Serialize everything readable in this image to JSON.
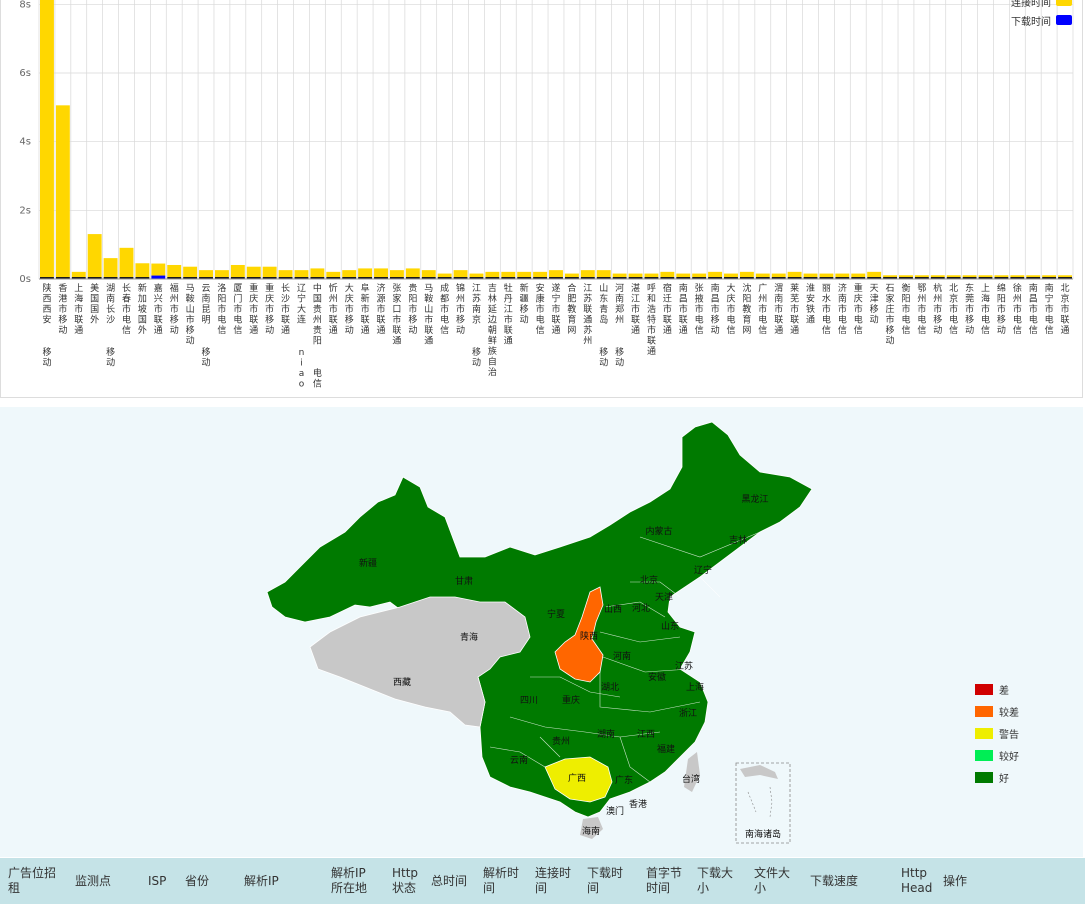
{
  "chart_data": {
    "type": "bar",
    "ylim": [
      0,
      9
    ],
    "yticks": [
      "0s",
      "2s",
      "4s",
      "6s",
      "8s"
    ],
    "ytick_values": [
      0,
      2,
      4,
      6,
      8
    ],
    "series": [
      {
        "name": "连接时间",
        "color": "#ffd700",
        "values": [
          10.5,
          5.0,
          0.15,
          1.25,
          0.55,
          0.85,
          0.4,
          0.35,
          0.35,
          0.3,
          0.2,
          0.2,
          0.35,
          0.3,
          0.3,
          0.2,
          0.2,
          0.25,
          0.15,
          0.2,
          0.25,
          0.25,
          0.2,
          0.25,
          0.2,
          0.1,
          0.2,
          0.1,
          0.15,
          0.15,
          0.15,
          0.15,
          0.2,
          0.1,
          0.2,
          0.2,
          0.1,
          0.1,
          0.1,
          0.15,
          0.1,
          0.1,
          0.15,
          0.1,
          0.15,
          0.1,
          0.1,
          0.15,
          0.1,
          0.1,
          0.1,
          0.1,
          0.15,
          0.05,
          0.05,
          0.05,
          0.05,
          0.05,
          0.05,
          0.05,
          0.05,
          0.05,
          0.05,
          0.05,
          0.05
        ]
      },
      {
        "name": "下载时间",
        "color": "#0000ff",
        "values": [
          0.02,
          0.01,
          0.01,
          0.01,
          0.01,
          0.01,
          0.01,
          0.1,
          0.01,
          0.01,
          0.01,
          0.01,
          0.01,
          0.01,
          0.01,
          0.01,
          0.01,
          0.01,
          0.01,
          0.01,
          0.01,
          0.01,
          0.01,
          0.01,
          0.01,
          0.01,
          0.01,
          0.01,
          0.01,
          0.01,
          0.01,
          0.01,
          0.01,
          0.01,
          0.01,
          0.01,
          0.01,
          0.01,
          0.01,
          0.01,
          0.01,
          0.01,
          0.01,
          0.01,
          0.01,
          0.01,
          0.01,
          0.01,
          0.01,
          0.01,
          0.01,
          0.01,
          0.01,
          0.01,
          0.01,
          0.01,
          0.01,
          0.01,
          0.01,
          0.01,
          0.01,
          0.01,
          0.01,
          0.01,
          0.01
        ]
      }
    ],
    "categories": [
      "陕西西安 移动",
      "香港市移动",
      "上海市联通",
      "美国国外",
      "湖南长沙 移动",
      "长春市电信",
      "新加坡国外",
      "嘉兴市联通",
      "福州市移动",
      "马鞍山市移动",
      "云南昆明 移动",
      "洛阳市电信",
      "厦门市电信",
      "重庆市联通",
      "重庆市移动",
      "长沙市联通",
      "辽宁大连 niao",
      "中国贵州贵阳 电信",
      "忻州市联通",
      "大庆市移动",
      "阜新市联通",
      "济源市联通",
      "张家口市联通",
      "贵阳市移动",
      "马鞍山市联通",
      "成都市电信",
      "锦州市移动",
      "江苏南京 移动",
      "吉林延边朝鲜族自治",
      "牡丹江市联通",
      "新疆移动",
      "安康市电信",
      "遂宁市联通",
      "合肥教育网",
      "江苏联通苏州",
      "山东青岛 移动",
      "河南郑州 移动",
      "湛江市联通",
      "呼和浩特市联通",
      "宿迁市联通",
      "南昌市联通",
      "张掖市电信",
      "南昌市移动",
      "大庆市电信",
      "沈阳教育网",
      "广州市电信",
      "渭南市联通",
      "莱芜市联通",
      "淮安铁通",
      "丽水市电信",
      "济南市电信",
      "重庆市电信",
      "天津移动",
      "石家庄市移动",
      "衡阳市电信",
      "鄂州市电信",
      "杭州市移动",
      "北京市电信",
      "东莞市移动",
      "上海市电信",
      "绵阳市移动",
      "徐州市电信",
      "南昌市电信",
      "南宁市电信",
      "北京市联通"
    ],
    "legend_placement": "top-right"
  },
  "map": {
    "legend": [
      {
        "label": "差",
        "color": "#d00000"
      },
      {
        "label": "较差",
        "color": "#ff6600"
      },
      {
        "label": "警告",
        "color": "#eeee00"
      },
      {
        "label": "较好",
        "color": "#00ee55"
      },
      {
        "label": "好",
        "color": "#007a00"
      }
    ],
    "provinces": [
      "黑龙江",
      "吉林",
      "辽宁",
      "内蒙古",
      "北京",
      "天津",
      "河北",
      "山西",
      "山东",
      "新疆",
      "甘肃",
      "宁夏",
      "陕西",
      "河南",
      "江苏",
      "上海",
      "安徽",
      "青海",
      "西藏",
      "四川",
      "重庆",
      "湖北",
      "浙江",
      "贵州",
      "湖南",
      "江西",
      "福建",
      "云南",
      "广西",
      "广东",
      "台湾",
      "香港",
      "澳门",
      "海南"
    ],
    "inset_label": "南海诸岛",
    "colors": {
      "good": "#007a00",
      "poor": "#ff6600",
      "warning": "#eeee00",
      "nodata": "#c8c8c8"
    }
  },
  "table": {
    "headers": [
      [
        "广告位招",
        "租"
      ],
      [
        "监测点"
      ],
      [
        "ISP"
      ],
      [
        "省份"
      ],
      [
        "解析IP"
      ],
      [
        "解析IP",
        "所在地"
      ],
      [
        "Http",
        "状态"
      ],
      [
        "总时间"
      ],
      [
        "解析时",
        "间"
      ],
      [
        "连接时",
        "间"
      ],
      [
        "下载时",
        "间"
      ],
      [
        "首字节",
        "时间"
      ],
      [
        "下载大",
        "小"
      ],
      [
        "文件大",
        "小"
      ],
      [
        "下载速度"
      ],
      [
        "Http",
        "Head"
      ],
      [
        "操作"
      ]
    ]
  }
}
